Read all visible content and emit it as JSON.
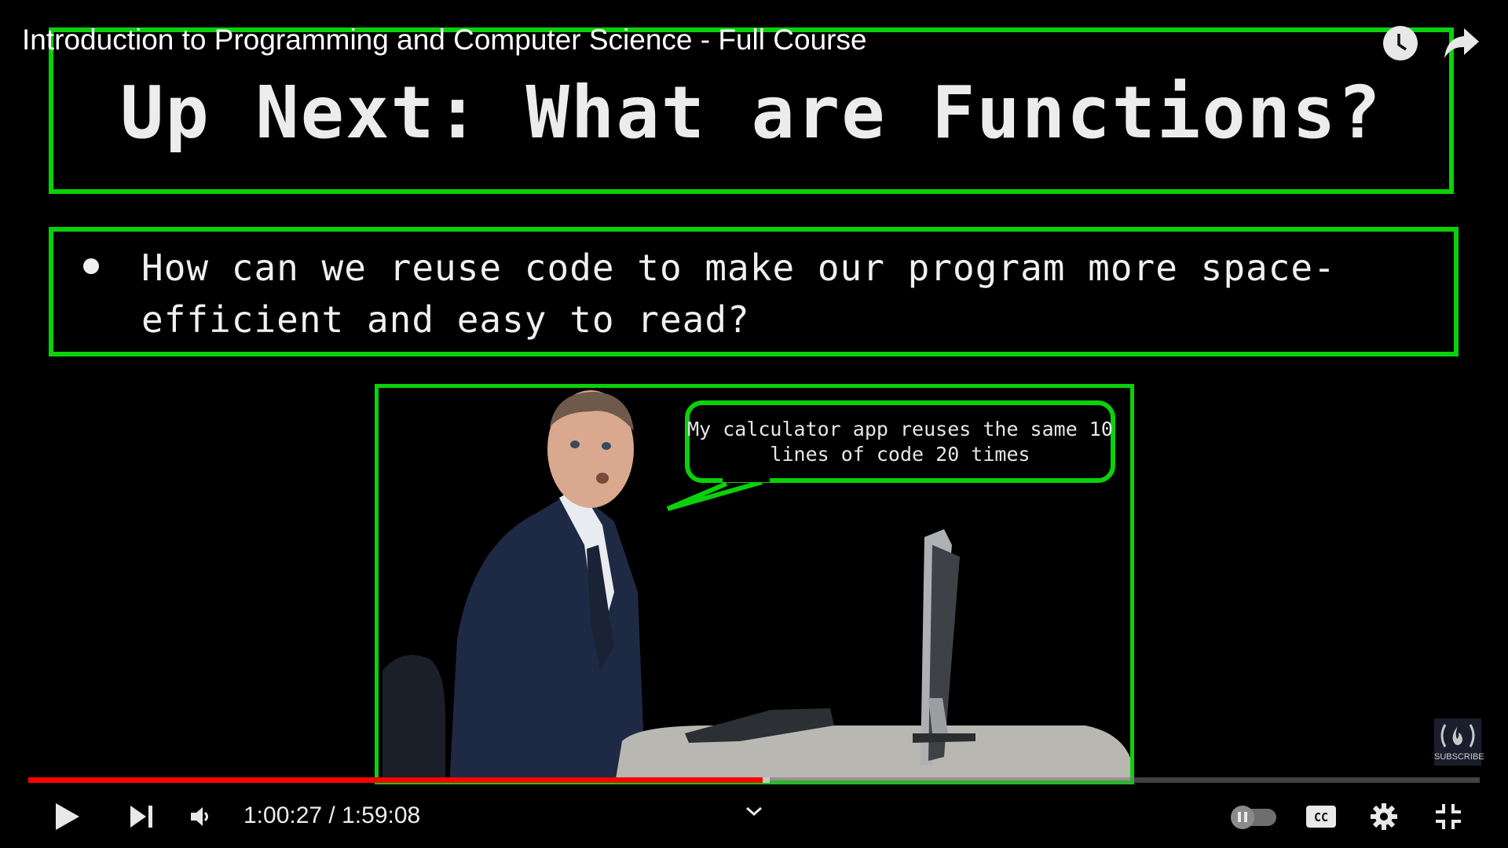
{
  "video": {
    "title": "Introduction to Programming and Computer Science - Full Course",
    "current_time": "1:00:27",
    "duration": "1:59:08",
    "time_separator": " / ",
    "progress_fraction": 0.506,
    "buffered_fraction": 0.511
  },
  "slide": {
    "heading": "Up Next: What are Functions?",
    "bullets": [
      "How can we reuse code to make our program more space-efficient and easy to read?"
    ],
    "speech_bubble": "My calculator app reuses the same 10 lines of code 20 times",
    "accent_color": "#0ad10a"
  },
  "overlay": {
    "watch_later_icon": "clock-icon",
    "share_icon": "share-arrow-icon",
    "subscribe_label": "SUBSCRIBE",
    "channel_logo_glyph": "(🔥)"
  },
  "controls": {
    "play_icon": "play-icon",
    "next_icon": "skip-next-icon",
    "volume_icon": "volume-icon",
    "chapter_icon": "chevron-down-icon",
    "autoplay_icon": "autoplay-toggle",
    "cc_label": "CC",
    "settings_icon": "gear-icon",
    "fullscreen_icon": "exit-fullscreen-icon",
    "progress_color": "#ff0000"
  }
}
